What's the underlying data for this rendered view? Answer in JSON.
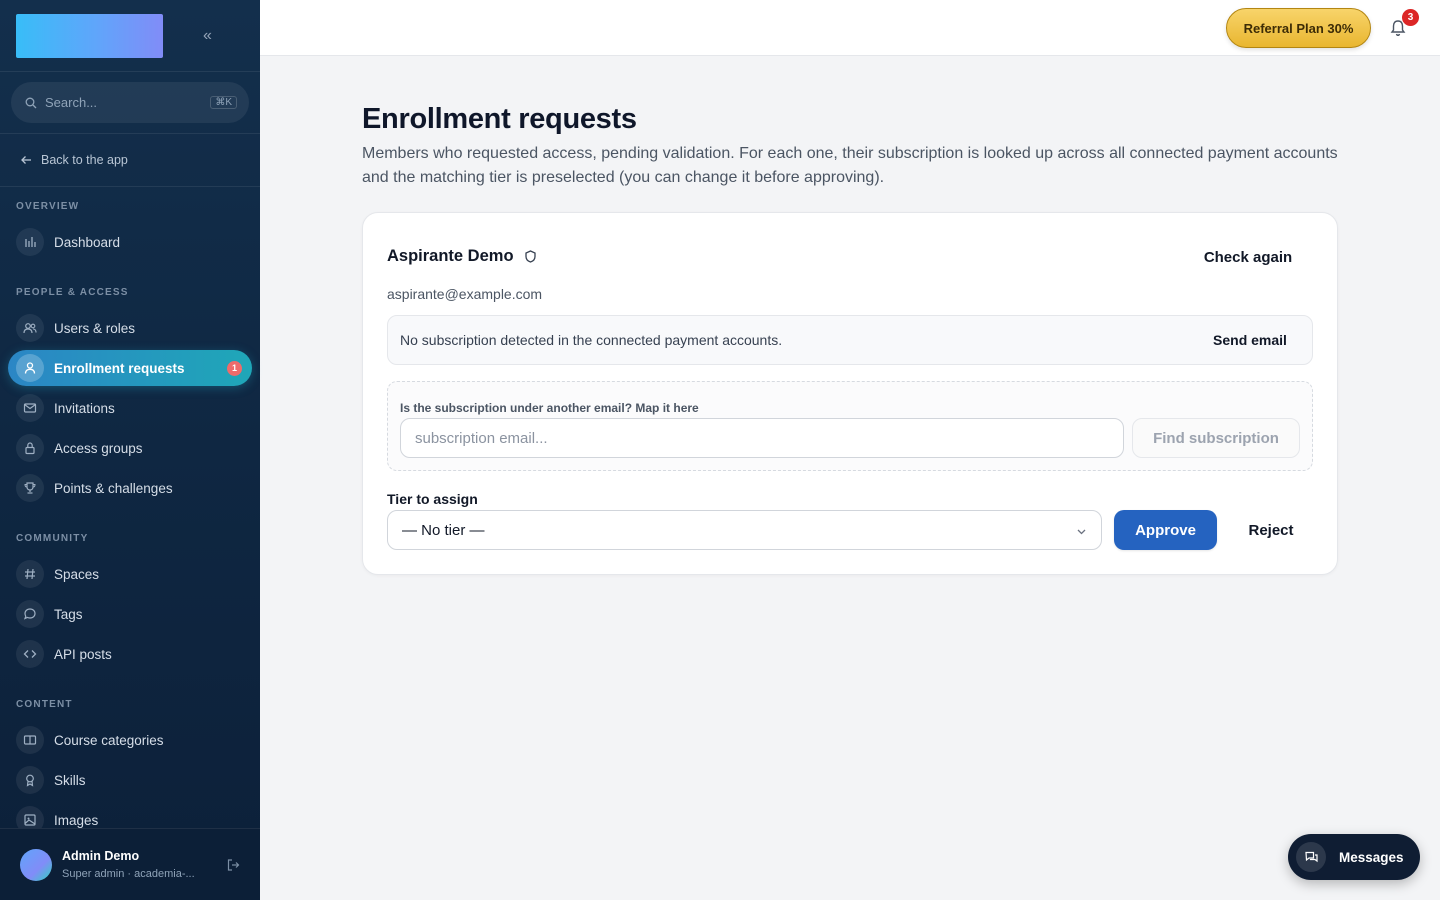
{
  "sidebar": {
    "search_placeholder": "Search...",
    "search_shortcut": "⌘K",
    "back_label": "Back to the app",
    "sections": {
      "overview": "OVERVIEW",
      "people": "PEOPLE & ACCESS",
      "community": "COMMUNITY",
      "content": "CONTENT"
    },
    "items": {
      "dashboard": "Dashboard",
      "users": "Users & roles",
      "enrollment": "Enrollment requests",
      "enrollment_count": "1",
      "invitations": "Invitations",
      "access_groups": "Access groups",
      "points": "Points & challenges",
      "spaces": "Spaces",
      "tags": "Tags",
      "api_posts": "API posts",
      "course_categories": "Course categories",
      "skills": "Skills",
      "images": "Images"
    },
    "user": {
      "name": "Admin Demo",
      "role": "Super admin · academia-..."
    }
  },
  "topbar": {
    "referral_label": "Referral Plan 30%",
    "notification_count": "3"
  },
  "page": {
    "title": "Enrollment requests",
    "description": "Members who requested access, pending validation. For each one, their subscription is looked up across all connected payment accounts and the matching tier is preselected (you can change it before approving)."
  },
  "request": {
    "member_name": "Aspirante Demo",
    "member_email": "aspirante@example.com",
    "check_again_label": "Check again",
    "notice_text": "No subscription detected in the connected payment accounts.",
    "send_email_label": "Send email",
    "map_label": "Is the subscription under another email? Map it here",
    "map_placeholder": "subscription email...",
    "find_label": "Find subscription",
    "tier_label": "Tier to assign",
    "tier_value": "— No tier —",
    "approve_label": "Approve",
    "reject_label": "Reject"
  },
  "messages_label": "Messages",
  "colors": {
    "accent": "#2563c0",
    "sidebar_bg": "#0f2742",
    "active_gradient_start": "#2b86c5",
    "active_gradient_end": "#1fa7b8",
    "referral_gold": "#f0c44a",
    "badge_red": "#dc2626"
  }
}
